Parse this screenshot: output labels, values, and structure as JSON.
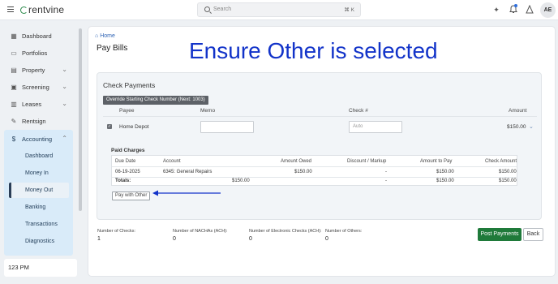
{
  "app": {
    "logo_text": "rentvine"
  },
  "search": {
    "placeholder": "Search",
    "shortcut": "⌘ K"
  },
  "user": {
    "initials": "AE"
  },
  "sidebar": {
    "items": [
      {
        "label": "Dashboard",
        "icon": "grid-icon"
      },
      {
        "label": "Portfolios",
        "icon": "folder-icon"
      },
      {
        "label": "Property",
        "icon": "building-icon",
        "has_chevron": true
      },
      {
        "label": "Screening",
        "icon": "screening-icon",
        "has_chevron": true
      },
      {
        "label": "Leases",
        "icon": "lease-icon",
        "has_chevron": true
      },
      {
        "label": "Rentsign",
        "icon": "rentsign-icon"
      },
      {
        "label": "Accounting",
        "icon": "dollar-icon",
        "has_chevron": true,
        "expanded": true
      }
    ],
    "accounting_sub": [
      {
        "label": "Dashboard"
      },
      {
        "label": "Money In"
      },
      {
        "label": "Money Out",
        "active": true
      },
      {
        "label": "Banking"
      },
      {
        "label": "Transactions"
      },
      {
        "label": "Diagnostics"
      }
    ],
    "clock": "123 PM"
  },
  "main": {
    "breadcrumb": "Home",
    "title": "Pay Bills",
    "annotation": "Ensure Other is selected",
    "check_payments": {
      "title": "Check Payments",
      "override_label": "Override Starting Check Number (Next: 1003)",
      "columns": {
        "payee": "Payee",
        "memo": "Memo",
        "check": "Check #",
        "amount": "Amount"
      },
      "row": {
        "payee": "Home Depot",
        "memo": "",
        "check_placeholder": "Auto",
        "amount": "$150.00",
        "checked": true
      },
      "paid_charges": {
        "label": "Paid Charges",
        "headers": [
          "Due Date",
          "Account",
          "Amount Owed",
          "Discount / Markup",
          "Amount to Pay",
          "Check Amount"
        ],
        "row": [
          "06-19-2025",
          "6345: General Repairs",
          "$150.00",
          "-",
          "$150.00",
          "$150.00"
        ],
        "totals": {
          "label": "Totals:",
          "amount_owed": "$150.00",
          "discount": "-",
          "amount_to_pay": "$150.00",
          "check_amount": "$150.00"
        }
      },
      "pay_other_label": "Pay with Other"
    },
    "stats": [
      {
        "label": "Number of Checks:",
        "value": "1"
      },
      {
        "label": "Number of NACHAs (ACH):",
        "value": "0"
      },
      {
        "label": "Number of Electronic Checks (ACH):",
        "value": "0"
      },
      {
        "label": "Number of Others:",
        "value": "0"
      }
    ],
    "post_label": "Post Payments",
    "back_label": "Back"
  },
  "colors": {
    "accent_green": "#1f7a3a",
    "annotation_blue": "#1233c9",
    "sidebar_active_bg": "#d9ebf9"
  }
}
